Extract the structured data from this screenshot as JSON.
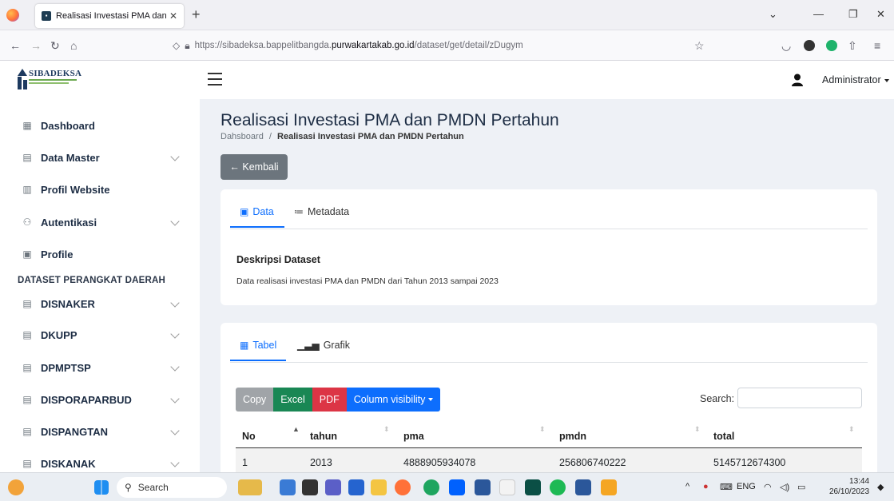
{
  "browser": {
    "tab_title": "Realisasi Investasi PMA dan PM",
    "url_prefix": "https://sibadeksa.bappelitbangda.",
    "url_domain": "purwakartakab.go.id",
    "url_path": "/dataset/get/detail/zDugym"
  },
  "header": {
    "brand": "SIBADEKSA",
    "user": "Administrator"
  },
  "sidebar": {
    "items": [
      {
        "label": "Dashboard",
        "icon": "grid-icon",
        "glyph": "▦",
        "chevron": false
      },
      {
        "label": "Data Master",
        "icon": "database-icon",
        "glyph": "▤",
        "chevron": true
      },
      {
        "label": "Profil Website",
        "icon": "building-icon",
        "glyph": "▥",
        "chevron": false
      },
      {
        "label": "Autentikasi",
        "icon": "users-icon",
        "glyph": "⚇",
        "chevron": true
      },
      {
        "label": "Profile",
        "icon": "card-icon",
        "glyph": "▣",
        "chevron": false
      }
    ],
    "section_title": "DATASET PERANGKAT DAERAH",
    "datasets": [
      {
        "label": "DISNAKER"
      },
      {
        "label": "DKUPP"
      },
      {
        "label": "DPMPTSP"
      },
      {
        "label": "DISPORAPARBUD"
      },
      {
        "label": "DISPANGTAN"
      },
      {
        "label": "DISKANAK"
      }
    ]
  },
  "main": {
    "title": "Realisasi Investasi PMA dan PMDN Pertahun",
    "breadcrumb_home": "Dahsboard",
    "breadcrumb_sep": "/",
    "breadcrumb_current": "Realisasi Investasi PMA dan PMDN Pertahun",
    "back_label": "← Kembali",
    "info_tabs": {
      "data": "Data",
      "metadata": "Metadata"
    },
    "desc_title": "Deskripsi Dataset",
    "desc_text": "Data realisasi investasi PMA dan PMDN dari Tahun 2013 sampai 2023",
    "view_tabs": {
      "table": "Tabel",
      "chart": "Grafik"
    },
    "buttons": {
      "copy": "Copy",
      "excel": "Excel",
      "pdf": "PDF",
      "colvis": "Column visibility"
    },
    "search_label": "Search:",
    "search_value": "",
    "table": {
      "columns": [
        "No",
        "tahun",
        "pma",
        "pmdn",
        "total"
      ],
      "rows": [
        [
          "1",
          "2013",
          "4888905934078",
          "256806740222",
          "5145712674300"
        ]
      ]
    }
  },
  "taskbar": {
    "search": "Search",
    "lang": "ENG",
    "time": "13:44",
    "date": "26/10/2023"
  }
}
